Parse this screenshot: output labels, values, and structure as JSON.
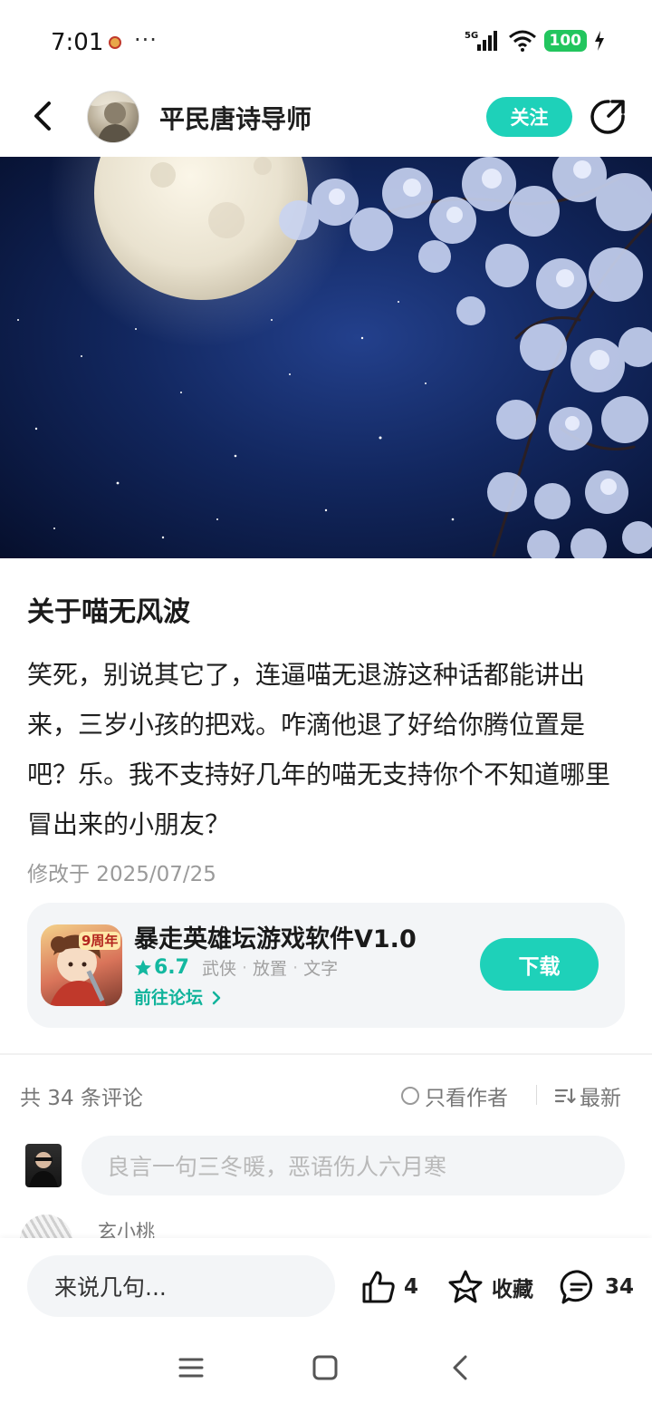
{
  "status_bar": {
    "time": "7:01",
    "more": "···",
    "network": "5G",
    "battery": "100"
  },
  "nav": {
    "author_name": "平民唐诗导师",
    "follow_label": "关注"
  },
  "post": {
    "title": "关于喵无风波",
    "body": "笑死，别说其它了，连逼喵无退游这种话都能讲出来，三岁小孩的把戏。咋滴他退了好给你腾位置是吧？乐。我不支持好几年的喵无支持你个不知道哪里冒出来的小朋友？",
    "edited": "修改于 2025/07/25"
  },
  "game_card": {
    "name": "暴走英雄坛游戏软件V1.0",
    "icon_badge": "9周年",
    "rating": "6.7",
    "tags": [
      "武侠",
      "放置",
      "文字"
    ],
    "forum_link": "前往论坛",
    "download_label": "下载"
  },
  "comments": {
    "count_label": "共 34 条评论",
    "only_author_label": "只看作者",
    "sort_label": "最新",
    "input_placeholder": "良言一句三冬暖，恶语伤人六月寒",
    "first_commenter": "玄小桃"
  },
  "bottom_bar": {
    "say_placeholder": "来说几句...",
    "like_count": "4",
    "favorite_label": "收藏",
    "comment_count": "34"
  },
  "colors": {
    "accent": "#1ed1b9",
    "accent_text": "#10b39b",
    "card_bg": "#f3f5f7",
    "hero_sky": "#12275f"
  }
}
